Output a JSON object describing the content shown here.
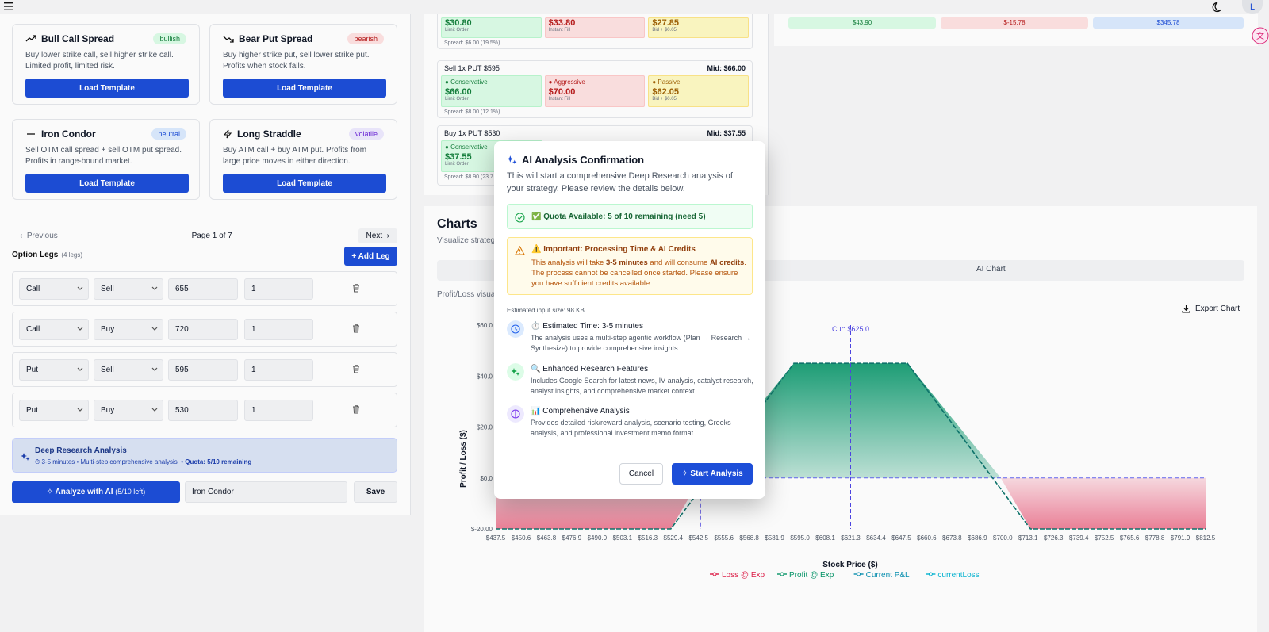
{
  "header": {
    "avatar_initial": "L"
  },
  "templates": [
    {
      "name": "Bull Call Spread",
      "badge": "bullish",
      "desc": "Buy lower strike call, sell higher strike call. Limited profit, limited risk.",
      "button": "Load Template"
    },
    {
      "name": "Bear Put Spread",
      "badge": "bearish",
      "desc": "Buy higher strike put, sell lower strike put. Profits when stock falls.",
      "button": "Load Template"
    },
    {
      "name": "Iron Condor",
      "badge": "neutral",
      "desc": "Sell OTM call spread + sell OTM put spread. Profits in range-bound market.",
      "button": "Load Template"
    },
    {
      "name": "Long Straddle",
      "badge": "volatile",
      "desc": "Buy ATM call + buy ATM put. Profits from large price moves in either direction.",
      "button": "Load Template"
    }
  ],
  "pager": {
    "previous": "Previous",
    "page_text": "Page 1 of 7",
    "next": "Next"
  },
  "legs": {
    "title": "Option Legs",
    "count": "(4 legs)",
    "add_label": "Add Leg",
    "rows": [
      {
        "type": "Call",
        "side": "Sell",
        "strike": "655",
        "qty": "1"
      },
      {
        "type": "Call",
        "side": "Buy",
        "strike": "720",
        "qty": "1"
      },
      {
        "type": "Put",
        "side": "Sell",
        "strike": "595",
        "qty": "1"
      },
      {
        "type": "Put",
        "side": "Buy",
        "strike": "530",
        "qty": "1"
      }
    ]
  },
  "research": {
    "title": "Deep Research Analysis",
    "sub": "3-5 minutes • Multi-step comprehensive analysis",
    "quota": "• Quota: 5/10 remaining"
  },
  "actions": {
    "analyze_label": "Analyze with AI",
    "analyze_count": "(5/10 left)",
    "strategy_name": "Iron Condor",
    "save_label": "Save"
  },
  "orders": [
    {
      "head": "",
      "mid": "",
      "tiles": [
        {
          "label": "",
          "price": "$30.80",
          "sub": "Limit Order"
        },
        {
          "label": "",
          "price": "$33.80",
          "sub": "Instant Fill"
        },
        {
          "label": "",
          "price": "$27.85",
          "sub": "Bid + $0.05"
        }
      ],
      "spread": "Spread: $6.00 (19.5%)"
    },
    {
      "head": "Sell 1x PUT $595",
      "mid": "Mid: $66.00",
      "tiles": [
        {
          "label": "Conservative",
          "price": "$66.00",
          "sub": "Limit Order"
        },
        {
          "label": "Aggressive",
          "price": "$70.00",
          "sub": "Instant Fill"
        },
        {
          "label": "Passive",
          "price": "$62.05",
          "sub": "Bid + $0.05"
        }
      ],
      "spread": "Spread: $8.00 (12.1%)"
    },
    {
      "head": "Buy 1x PUT $530",
      "mid": "Mid: $37.55",
      "tiles": [
        {
          "label": "Conservative",
          "price": "$37.55",
          "sub": "Limit Order"
        }
      ],
      "spread": "Spread: $8.90 (23.7"
    }
  ],
  "right_top": {
    "chip1": "$43.90",
    "chip2": "$-15.78",
    "chip3": "$345.78"
  },
  "charts": {
    "title": "Charts",
    "sub": "Visualize strateg",
    "ai_tab": "AI Chart",
    "desc": "Profit/Loss visua",
    "export": "Export Chart"
  },
  "chart_data": {
    "type": "area",
    "title": "",
    "xlabel": "Stock Price ($)",
    "ylabel": "Profit / Loss ($)",
    "x_ticks": [
      "$437.5",
      "$450.6",
      "$463.8",
      "$476.9",
      "$490.0",
      "$503.1",
      "$516.3",
      "$529.4",
      "$542.5",
      "$555.6",
      "$568.8",
      "$581.9",
      "$595.0",
      "$608.1",
      "$621.3",
      "$634.4",
      "$647.5",
      "$660.6",
      "$673.8",
      "$686.9",
      "$700.0",
      "$713.1",
      "$726.3",
      "$739.4",
      "$752.5",
      "$765.6",
      "$778.8",
      "$791.9",
      "$812.5"
    ],
    "y_ticks": [
      "$-20.00",
      "$0.0",
      "$20.0",
      "$40.0",
      "$60.0"
    ],
    "ylim": [
      -20,
      60
    ],
    "x": [
      437.5,
      530,
      595,
      655,
      720,
      812.5
    ],
    "series": [
      {
        "name": "Loss @ Exp",
        "color": "#e11d48"
      },
      {
        "name": "Profit @ Exp",
        "color": "#059669"
      },
      {
        "name": "Current P&L",
        "color": "#0891b2"
      },
      {
        "name": "currentLoss",
        "color": "#06b6d4"
      }
    ],
    "payoff": [
      -20,
      -20,
      45,
      45,
      -20,
      -20
    ],
    "annotation": "Cur: $625.0",
    "current_price": 625.0,
    "breakevens": [
      545.7,
      704.3
    ],
    "legend_position": "bottom"
  },
  "modal": {
    "title": "AI Analysis Confirmation",
    "desc": "This will start a comprehensive Deep Research analysis of your strategy. Please review the details below.",
    "quota": "✅ Quota Available: 5 of 10 remaining (need 5)",
    "warn_title": "⚠️ Important: Processing Time & AI Credits",
    "warn_pre": "This analysis will take",
    "warn_time": "3-5 minutes",
    "warn_mid": "and will consume",
    "warn_credits": "AI credits",
    "warn_post": ". The process cannot be cancelled once started. Please ensure you have sufficient credits available.",
    "est_size": "Estimated input size: 98 KB",
    "features": [
      {
        "title": "⏱️ Estimated Time: 3-5 minutes",
        "body": "The analysis uses a multi-step agentic workflow (Plan → Research → Synthesize) to provide comprehensive insights."
      },
      {
        "title": "🔍 Enhanced Research Features",
        "body": "Includes Google Search for latest news, IV analysis, catalyst research, analyst insights, and comprehensive market context."
      },
      {
        "title": "📊 Comprehensive Analysis",
        "body": "Provides detailed risk/reward analysis, scenario testing, Greeks analysis, and professional investment memo format."
      }
    ],
    "cancel": "Cancel",
    "start": "Start Analysis"
  }
}
